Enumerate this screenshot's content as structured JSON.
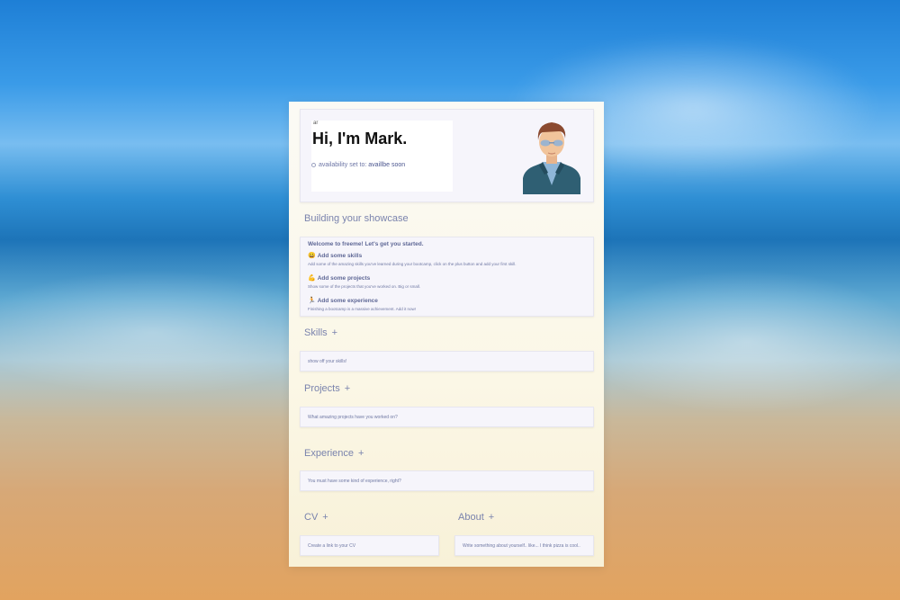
{
  "hero": {
    "tiny_label": "ar",
    "title": "Hi, I'm Mark.",
    "availability_label": "availability set to:",
    "availability_value": "availlbe soon"
  },
  "showcase": {
    "title": "Building your showcase",
    "welcome_title": "Welcome to freeme! Let's get you started.",
    "items": [
      {
        "icon": "smile-emoji",
        "emoji": "😀",
        "title": "Add some skills",
        "desc": "Add some of the amazing skills you've learned during your bootcamp, click on the plus button and add your first skill."
      },
      {
        "icon": "flexed-biceps-emoji",
        "emoji": "💪",
        "title": "Add some projects",
        "desc": "Show some of the projects that you've worked on. Big or small."
      },
      {
        "icon": "runner-emoji",
        "emoji": "🏃",
        "title": "Add some experience",
        "desc": "Finishing a bootcamp is a massive achievement. Add it now!"
      }
    ]
  },
  "skills": {
    "title": "Skills",
    "add": "+",
    "placeholder": "show off your skills!"
  },
  "projects": {
    "title": "Projects",
    "add": "+",
    "placeholder": "What amazing projects have you worked on?"
  },
  "experience": {
    "title": "Experience",
    "add": "+",
    "placeholder": "You must have some kind of experience, right?"
  },
  "cv": {
    "title": "CV",
    "add": "+",
    "placeholder": "Create a link to your CV"
  },
  "about": {
    "title": "About",
    "add": "+",
    "placeholder": "Write something about yourself.. like... I think pizza is cool.."
  },
  "colors": {
    "accent": "#7a83ad",
    "card": "#f6f5fb",
    "page": "#fbf7e6"
  }
}
